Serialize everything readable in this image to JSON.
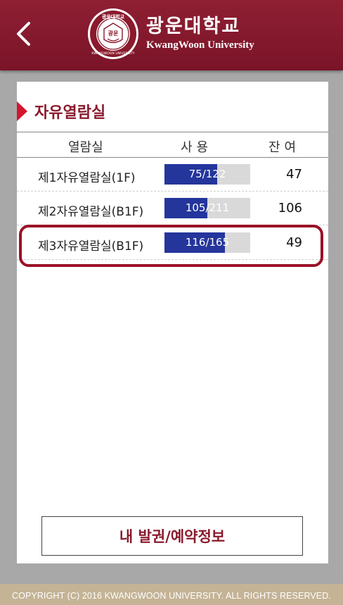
{
  "header": {
    "title_ko": "광운대학교",
    "title_en": "KwangWoon University",
    "back_icon": "chevron-left-icon",
    "emblem_ring_text": "광운대학교",
    "emblem_center_text": "광운",
    "emblem_bottom_text": "KWANGWOON UNIVERSITY",
    "colors": {
      "header_bg": "#7a1428",
      "accent": "#8a1a2c",
      "marker": "#d4162f"
    }
  },
  "section": {
    "title": "자유열람실"
  },
  "table": {
    "headers": {
      "room": "열람실",
      "usage": "사용",
      "remaining": "잔여"
    },
    "rows": [
      {
        "name": "제1자유열람실(1F)",
        "usage_label": "75/122",
        "used": 75,
        "total": 122,
        "remaining": "47"
      },
      {
        "name": "제2자유열람실(B1F)",
        "usage_label": "105/211",
        "used": 105,
        "total": 211,
        "remaining": "106"
      },
      {
        "name": "제3자유열람실(B1F)",
        "usage_label": "116/165",
        "used": 116,
        "total": 165,
        "remaining": "49",
        "highlighted": true
      }
    ],
    "bar_colors": {
      "fill": "#24359c",
      "track": "#d9d9d9"
    }
  },
  "ticket_button": {
    "label": "내 발권/예약정보"
  },
  "footer": {
    "copyright": "COPYRIGHT (C) 2016 KWANGWOON UNIVERSITY. ALL RIGHTS RESERVED."
  }
}
